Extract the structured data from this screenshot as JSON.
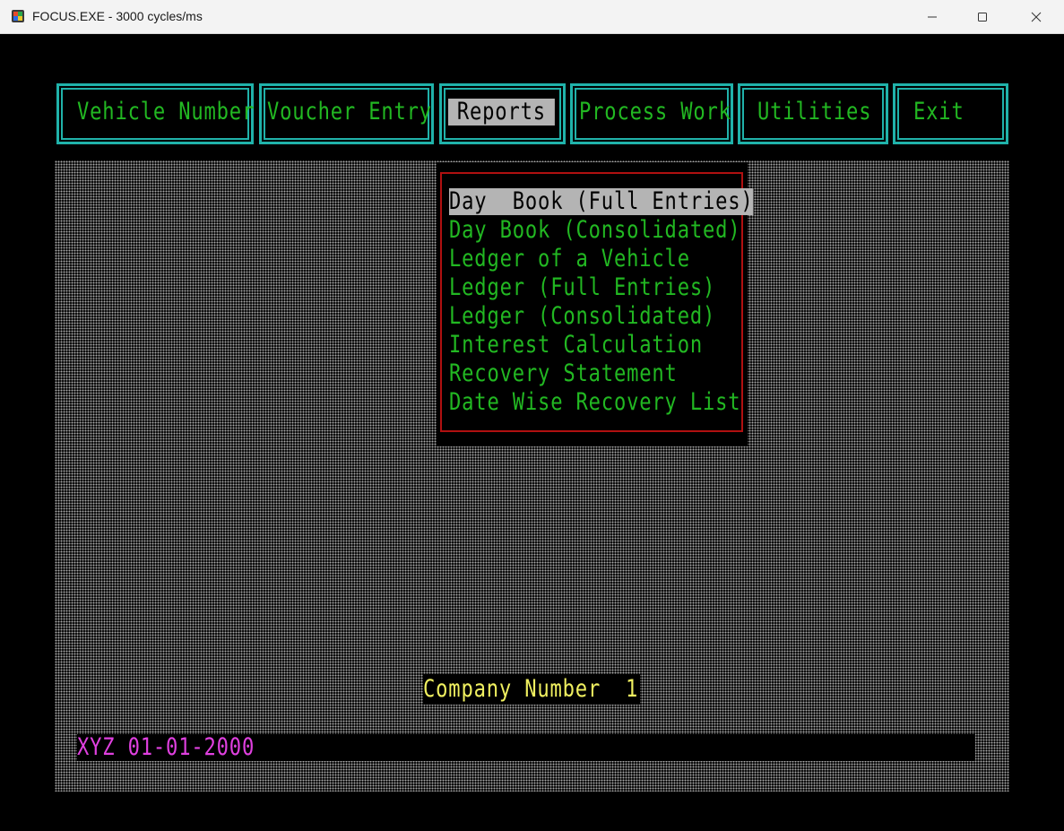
{
  "window": {
    "title": "FOCUS.EXE - 3000 cycles/ms",
    "icons": [
      "app-icon",
      "minimize-icon",
      "maximize-icon",
      "close-icon"
    ]
  },
  "menu": {
    "items": [
      {
        "label": "Vehicle Number"
      },
      {
        "label": "Voucher Entry"
      },
      {
        "label": "Reports",
        "selected": true
      },
      {
        "label": "Process Work"
      },
      {
        "label": "Utilities"
      },
      {
        "label": "Exit"
      }
    ]
  },
  "reports_menu": {
    "items": [
      {
        "label": "Day  Book (Full Entries)",
        "selected": true
      },
      {
        "label": "Day Book (Consolidated)"
      },
      {
        "label": "Ledger of a Vehicle"
      },
      {
        "label": "Ledger (Full Entries)"
      },
      {
        "label": "Ledger (Consolidated)"
      },
      {
        "label": "Interest Calculation"
      },
      {
        "label": "Recovery Statement"
      },
      {
        "label": "Date Wise Recovery List"
      }
    ]
  },
  "company": {
    "label": "Company Number",
    "value": "1"
  },
  "status": {
    "text": "XYZ 01-01-2000"
  },
  "colors": {
    "menu_text": "#22b822",
    "menu_border": "#20b2aa",
    "highlight_bg": "#b4b4b4",
    "dropdown_border": "#b01010",
    "company_text": "#f0f060",
    "status_text": "#e040e0"
  }
}
